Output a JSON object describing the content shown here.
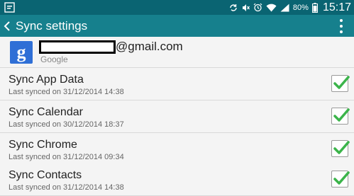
{
  "status_bar": {
    "battery": "80%",
    "time": "15:17",
    "icons": [
      "notification-icon",
      "sync-icon",
      "mute-icon",
      "alarm-icon",
      "wifi-icon",
      "signal-icon",
      "battery-icon"
    ]
  },
  "action_bar": {
    "title": "Sync settings",
    "back_icon": "chevron-left-icon",
    "overflow_icon": "more-vert-icon"
  },
  "account": {
    "email_suffix": "@gmail.com",
    "provider": "Google",
    "icon": "google-icon"
  },
  "sync_items": [
    {
      "title": "Sync App Data",
      "subtitle": "Last synced on 31/12/2014 14:38",
      "checked": true
    },
    {
      "title": "Sync Calendar",
      "subtitle": "Last synced on 30/12/2014 18:37",
      "checked": true
    },
    {
      "title": "Sync Chrome",
      "subtitle": "Last synced on 31/12/2014 09:34",
      "checked": true
    },
    {
      "title": "Sync Contacts",
      "subtitle": "Last synced on 31/12/2014 14:38",
      "checked": true
    }
  ],
  "colors": {
    "status_bar": "#0a6472",
    "action_bar": "#16808d",
    "check": "#3bb44a",
    "background": "#f4f4f4"
  }
}
